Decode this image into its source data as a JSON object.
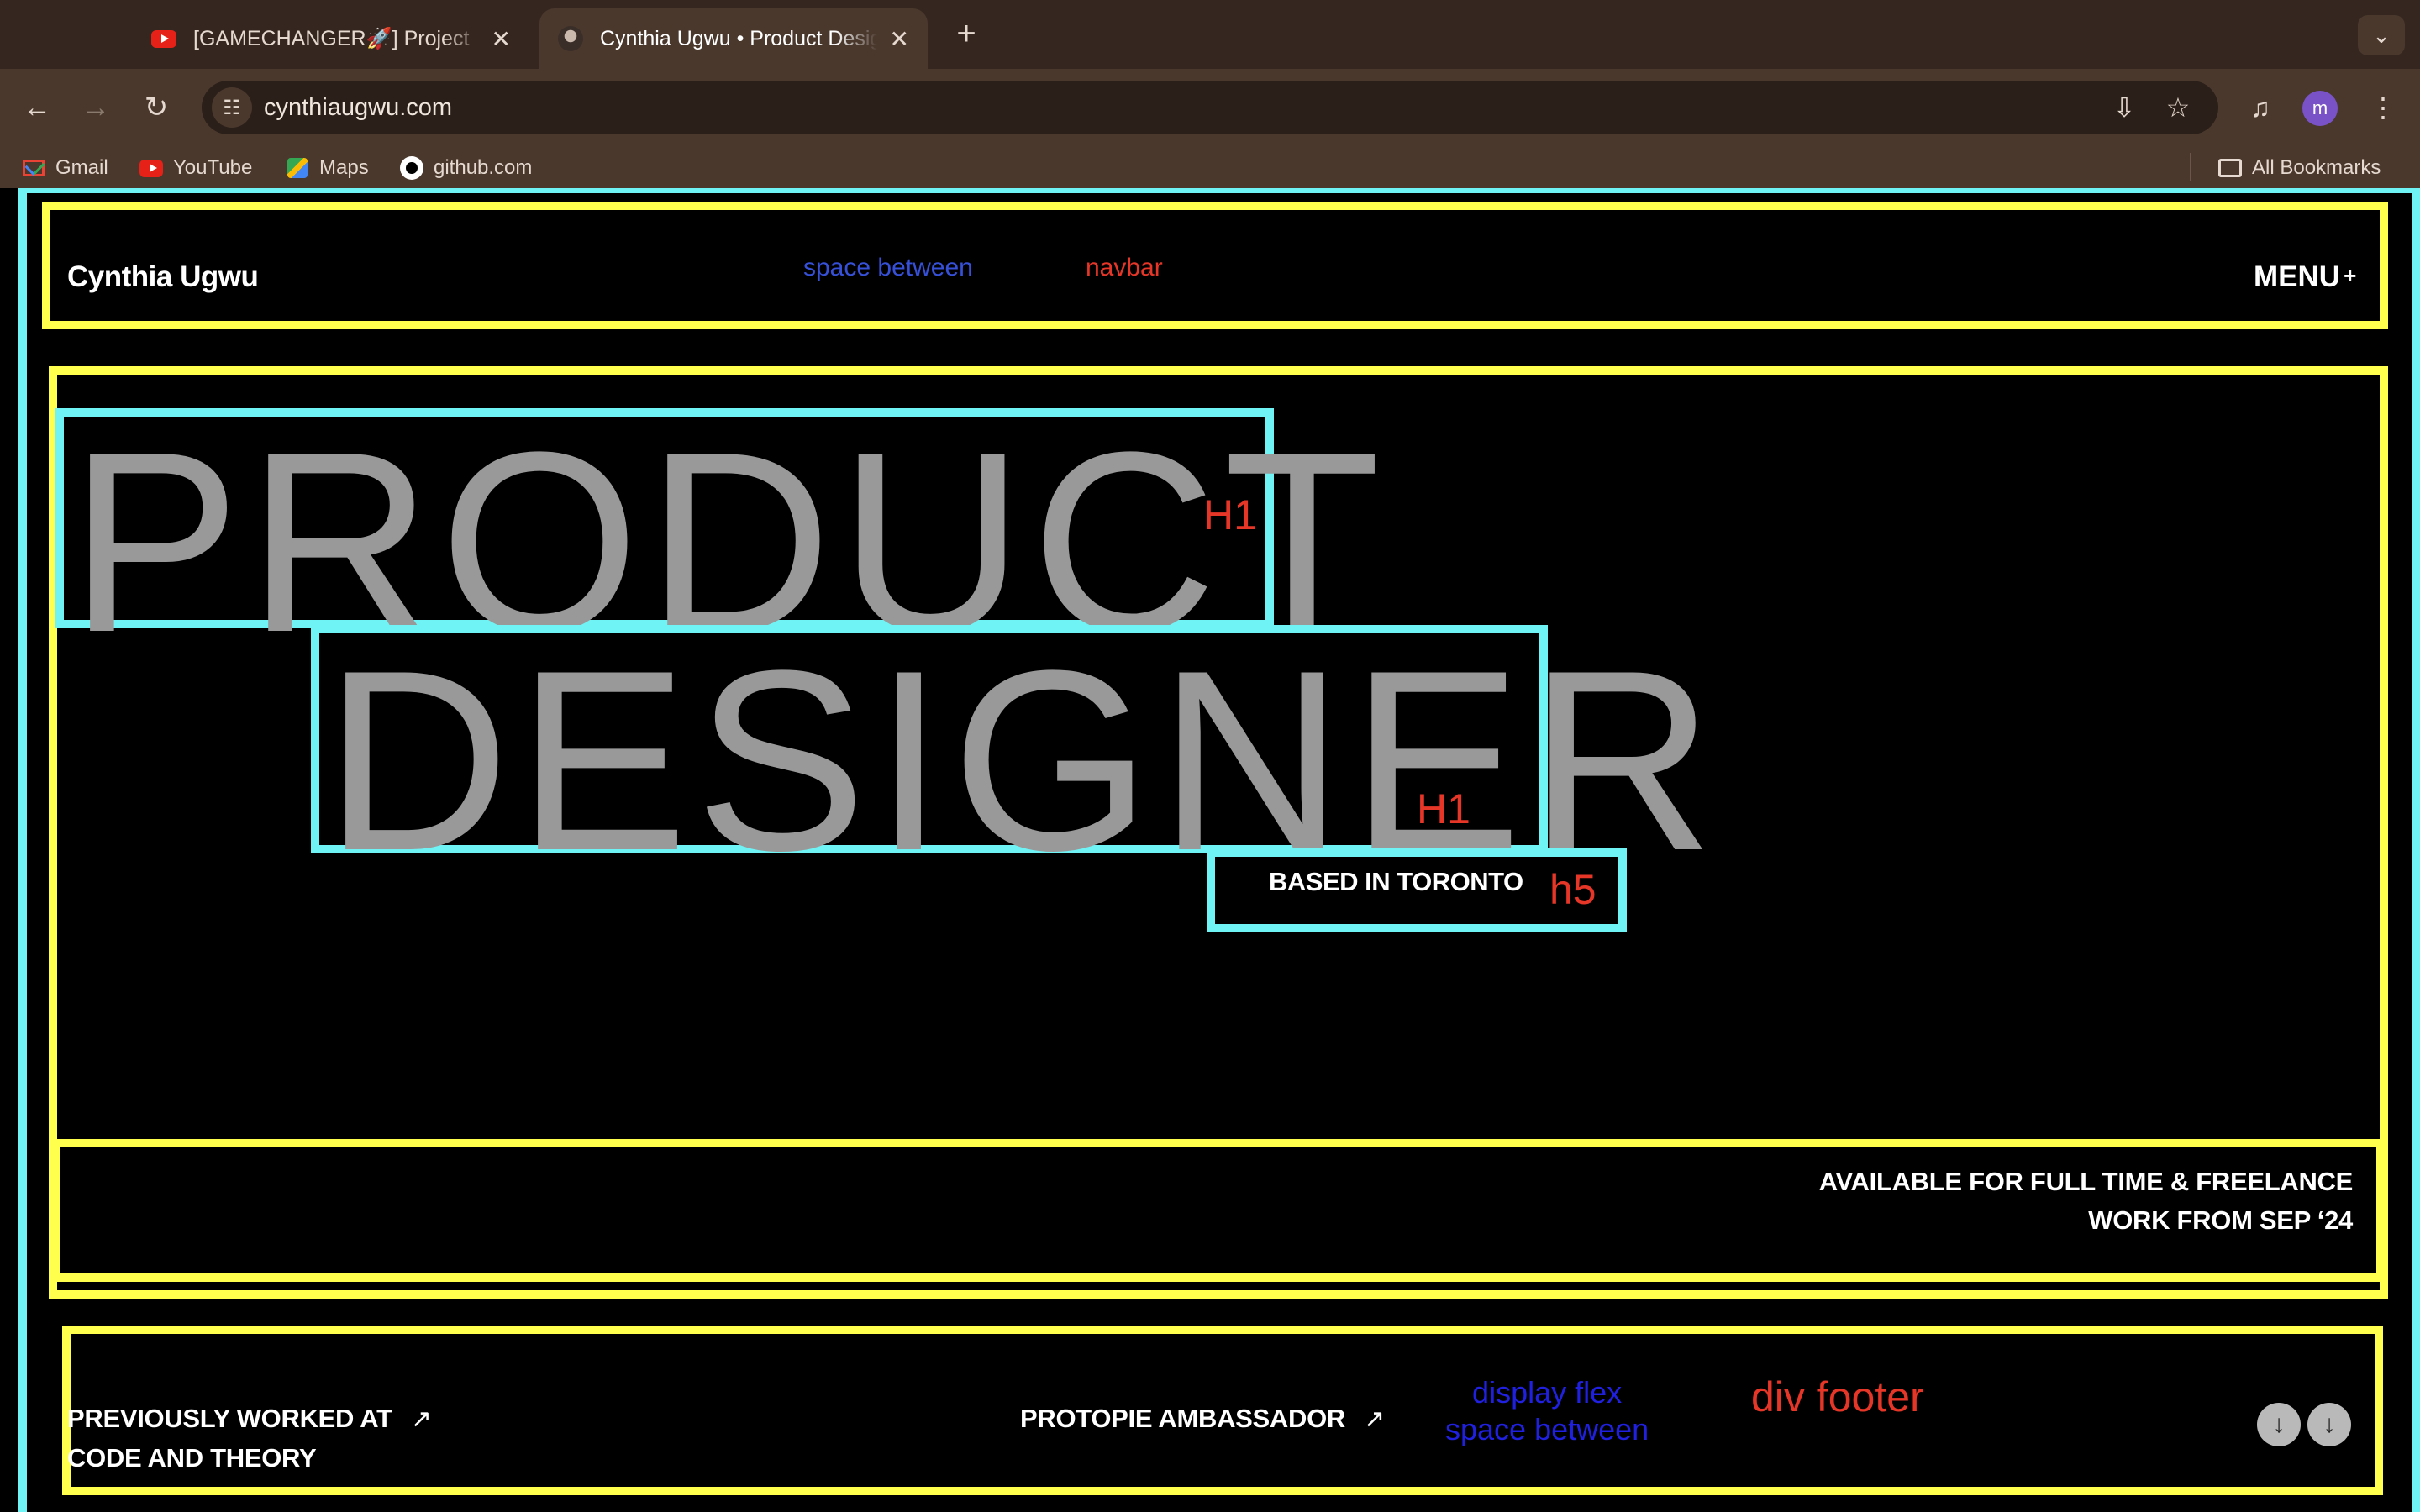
{
  "browser": {
    "tabs": [
      {
        "title": "[GAMECHANGER🚀] Project",
        "icon": "youtube-icon",
        "active": false
      },
      {
        "title": "Cynthia Ugwu • Product Design",
        "icon": "avatar-icon",
        "active": true
      }
    ],
    "new_tab": "+",
    "url": "cynthiaugwu.com",
    "profile_initial": "m",
    "bookmarks": [
      {
        "label": "Gmail",
        "icon": "gmail-icon"
      },
      {
        "label": "YouTube",
        "icon": "youtube-icon"
      },
      {
        "label": "Maps",
        "icon": "maps-icon"
      },
      {
        "label": "github.com",
        "icon": "github-icon"
      }
    ],
    "all_bookmarks": "All Bookmarks"
  },
  "site": {
    "logo": "Cynthia Ugwu",
    "menu_label": "MENU",
    "menu_plus": "+",
    "hero": {
      "line1": "PRODUCT",
      "line2": "DESIGNER",
      "subtitle": "BASED IN TORONTO"
    },
    "availability": {
      "line1": "AVAILABLE FOR FULL TIME & FREELANCE",
      "line2": "WORK FROM SEP ‘24"
    },
    "footer": {
      "item1_line1": "PREVIOUSLY WORKED AT",
      "item1_line2": "CODE AND THEORY",
      "item2": "PROTOPIE AMBASSADOR",
      "arrow": "↗",
      "scroll_icon": "↓"
    }
  },
  "annotations": {
    "space_between": "space between",
    "navbar": "navbar",
    "h1_a": "H1",
    "h1_b": "H1",
    "h5": "h5",
    "display_flex": "display flex",
    "space_between_2": "space between",
    "div_footer": "div footer",
    "colors": {
      "cyan": "#6ff3f5",
      "yellow": "#ffff4d",
      "blue": "#3650d8",
      "red": "#e63628"
    }
  }
}
